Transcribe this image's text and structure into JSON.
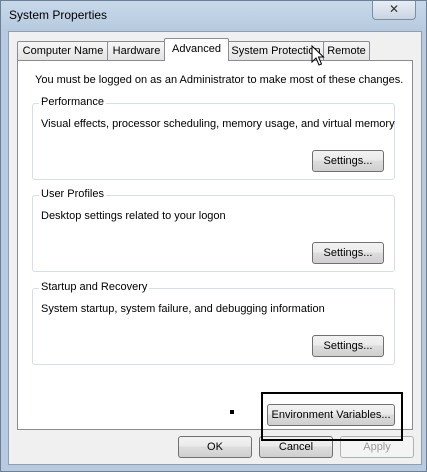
{
  "window": {
    "title": "System Properties",
    "close_label": "✕"
  },
  "tabs": [
    {
      "label": "Computer Name"
    },
    {
      "label": "Hardware"
    },
    {
      "label": "Advanced",
      "active": true
    },
    {
      "label": "System Protection"
    },
    {
      "label": "Remote"
    }
  ],
  "advanced": {
    "admin_notice": "You must be logged on as an Administrator to make most of these changes.",
    "performance": {
      "title": "Performance",
      "description": "Visual effects, processor scheduling, memory usage, and virtual memory",
      "button": "Settings..."
    },
    "user_profiles": {
      "title": "User Profiles",
      "description": "Desktop settings related to your logon",
      "button": "Settings..."
    },
    "startup_recovery": {
      "title": "Startup and Recovery",
      "description": "System startup, system failure, and debugging information",
      "button": "Settings..."
    },
    "env_button": "Environment Variables..."
  },
  "footer": {
    "ok": "OK",
    "cancel": "Cancel",
    "apply": "Apply"
  }
}
